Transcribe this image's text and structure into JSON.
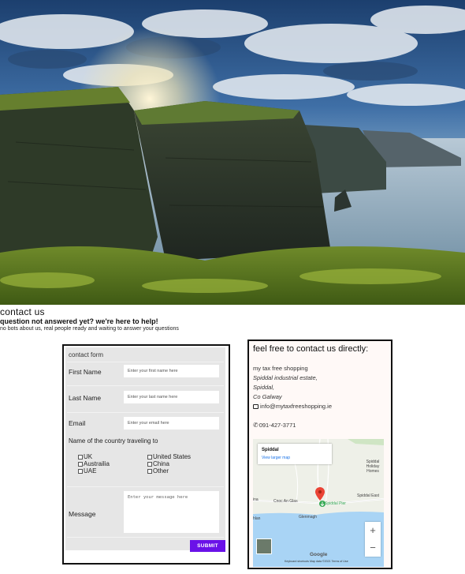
{
  "hero": {
    "image_description": "cliffs-of-moher-photo"
  },
  "contact": {
    "heading": "contact us",
    "subheading": "question not answered yet? we're here to help!",
    "note": "no bots about us, real people ready and waiting to answer your questions"
  },
  "form": {
    "title": "contact form",
    "first_name": {
      "label": "First Name",
      "placeholder": "Enter your first name here"
    },
    "last_name": {
      "label": "Last Name",
      "placeholder": "Enter your last name here"
    },
    "email": {
      "label": "Email",
      "placeholder": "Enter your email here"
    },
    "country_title": "Name of the country traveling to",
    "countries": [
      "UK",
      "United States",
      "Austrailia",
      "China",
      "UAE",
      "Other"
    ],
    "message": {
      "label": "Message",
      "placeholder": "Enter your message here"
    },
    "submit_label": "SUBMIT"
  },
  "details": {
    "title": "feel free to contact us directly:",
    "company": "my tax free shopping",
    "address_1": "Spiddal industrial estate,",
    "address_2": "Spiddal,",
    "address_3": "Co Galway",
    "email": "info@mytaxfreeshopping.ie",
    "phone": "091-427-3771"
  },
  "map": {
    "popup_title": "Spiddal",
    "popup_link": "View larger map",
    "labels": {
      "holiday_homes": "Spiddal Holiday Homes",
      "spiddal_east": "Spiddal East",
      "cnoc": "Cnoc An Glas",
      "pier": "Spiddal Pier",
      "glenagh": "Glenmagh",
      "ina": "ina",
      "hlan": "hlan"
    },
    "zoom_in": "+",
    "zoom_out": "−",
    "google": "Google",
    "footer": "Keyboard shortcuts   Map data ©2021   Terms of Use"
  },
  "colors": {
    "submit": "#6a11e8",
    "pin": "#ea4335",
    "pier": "#34a853",
    "sea": "#a9d4f5"
  }
}
